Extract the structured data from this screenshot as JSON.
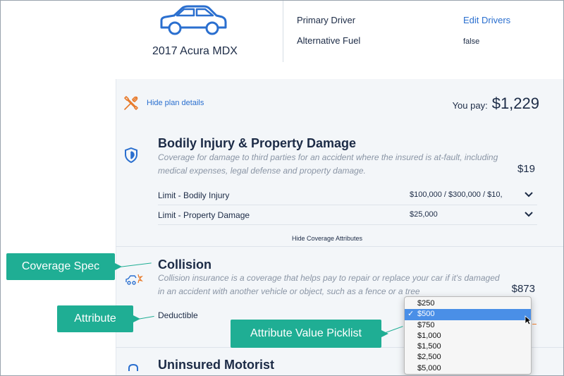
{
  "vehicle": {
    "name": "2017 Acura MDX",
    "primary_driver_label": "Primary Driver",
    "alternative_fuel_label": "Alternative Fuel",
    "edit_drivers_label": "Edit Drivers",
    "alternative_fuel_value": "false"
  },
  "plan": {
    "hide_plan_label": "Hide plan details",
    "you_pay_label": "You pay:",
    "you_pay_amount": "$1,229",
    "hide_coverage_attributes_label": "Hide Coverage Attributes"
  },
  "coverages": [
    {
      "title": "Bodily Injury & Property Damage",
      "description": "Coverage for damage to third parties for an accident where the insured is at-fault, including medical expenses, legal defense and property damage.",
      "price": "$19",
      "attributes": [
        {
          "label": "Limit - Bodily Injury",
          "value": "$100,000 / $300,000 / $10,"
        },
        {
          "label": "Limit - Property Damage",
          "value": "$25,000"
        }
      ]
    },
    {
      "title": "Collision",
      "description": "Collision insurance is a coverage that helps pay to repair or replace your car if it's damaged in an accident with another vehicle or object, such as a fence or a tree",
      "price": "$873",
      "attributes": [
        {
          "label": "Deductible"
        }
      ]
    },
    {
      "title": "Uninsured Motorist"
    }
  ],
  "picklist": {
    "options": [
      "$250",
      "$500",
      "$750",
      "$1,000",
      "$1,500",
      "$2,500",
      "$5,000"
    ],
    "selected": "$500"
  },
  "callouts": {
    "coverage_spec": "Coverage Spec",
    "attribute": "Attribute",
    "attribute_value_picklist": "Attribute Value Picklist"
  },
  "colors": {
    "accent_link": "#2a6fcf",
    "callout_bg": "#1fae94",
    "tools_icon": "#e87b2c",
    "picklist_selected": "#4a8fe7"
  },
  "icons": {
    "vehicle": "car-outline-icon",
    "hide_plan": "tools-icon",
    "bodily_injury": "shield-icon",
    "collision": "car-crash-icon",
    "uninsured_motorist": "lock-icon",
    "select": "chevron-down-icon"
  }
}
